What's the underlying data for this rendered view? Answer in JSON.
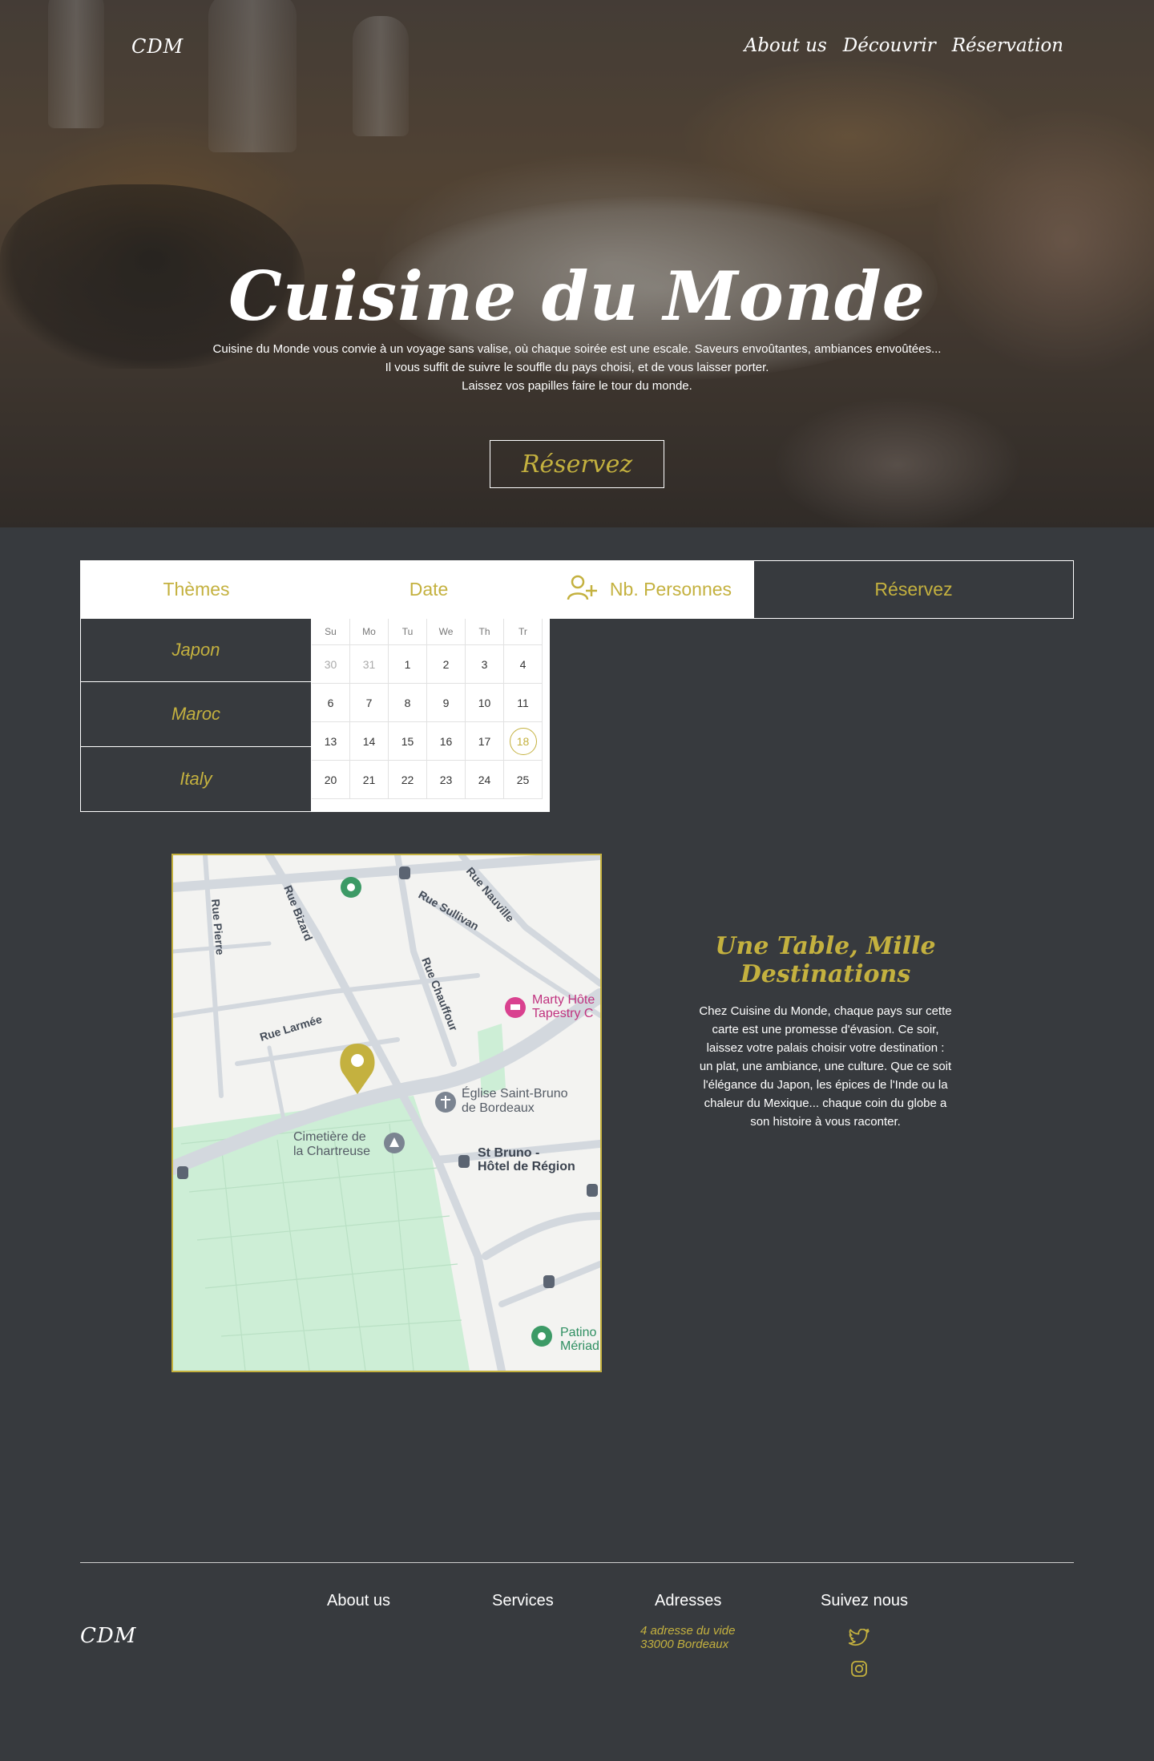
{
  "header": {
    "logo": "CDM",
    "nav": [
      "About us",
      "Découvrir",
      "Réservation"
    ]
  },
  "hero": {
    "title": "Cuisine du Monde",
    "lines": [
      "Cuisine du Monde vous convie à un voyage sans valise, où chaque soirée est une escale. Saveurs envoûtantes, ambiances envoûtées...",
      "Il vous suffit de suivre le souffle du pays choisi, et de vous laisser porter.",
      "Laissez vos papilles faire le tour du monde."
    ],
    "button": "Réservez"
  },
  "booking": {
    "themes_label": "Thèmes",
    "date_label": "Date",
    "persons_label": "Nb. Personnes",
    "persons_icon": "add-person-icon",
    "submit": "Réservez",
    "themes": [
      "Japon",
      "Maroc",
      "Italy"
    ]
  },
  "calendar": {
    "weekdays": [
      "Su",
      "Mo",
      "Tu",
      "We",
      "Th",
      "Tr"
    ],
    "weeks": [
      [
        "30",
        "31",
        "1",
        "2",
        "3",
        "4"
      ],
      [
        "6",
        "7",
        "8",
        "9",
        "10",
        "11"
      ],
      [
        "13",
        "14",
        "15",
        "16",
        "17",
        "18"
      ],
      [
        "20",
        "21",
        "22",
        "23",
        "24",
        "25"
      ]
    ],
    "muted": [
      "30",
      "31"
    ],
    "selected": "18"
  },
  "map": {
    "streets": [
      "Rue Pierre",
      "Rue Bizard",
      "Rue Sullivan",
      "Rue Nauville",
      "Rue Chauffour",
      "Rue Larmée"
    ],
    "places": [
      "Marty Hôte",
      "Tapestry C",
      "Église Saint-Bruno",
      "de Bordeaux",
      "Cimetière de",
      "la Chartreuse",
      "St Bruno -",
      "Hôtel de Région",
      "Patino",
      "Mériad"
    ]
  },
  "info": {
    "title": "Une Table, Mille Destinations",
    "lines": [
      "Chez Cuisine du Monde, chaque pays sur cette",
      "carte est une promesse d'évasion. Ce soir,",
      "laissez votre palais choisir votre destination :",
      "un plat, une ambiance, une culture. Que ce soit",
      "l'élégance du Japon, les épices de l'Inde ou la",
      "chaleur du Mexique... chaque coin du globe a",
      "son histoire à vous raconter."
    ]
  },
  "footer": {
    "logo": "CDM",
    "about": "About us",
    "services": "Services",
    "addresses": "Adresses",
    "follow": "Suivez nous",
    "address_lines": [
      "4 adresse du vide",
      "33000 Bordeaux"
    ],
    "social": [
      "twitter-icon",
      "instagram-icon"
    ]
  },
  "colors": {
    "accent": "#c4b13f",
    "background": "#373a3e"
  }
}
